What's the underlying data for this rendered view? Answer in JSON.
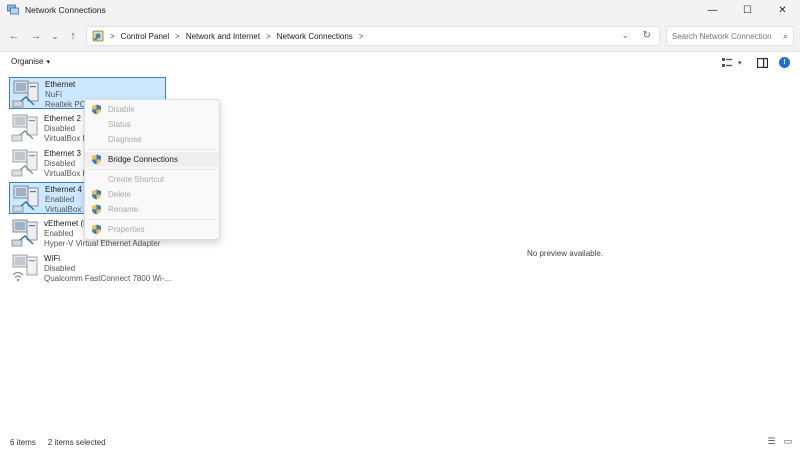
{
  "window": {
    "title": "Network Connections",
    "minimize": "—",
    "maximize": "☐",
    "close": "✕"
  },
  "nav": {
    "back": "←",
    "forward": "→",
    "recent": "⌄",
    "up": "↑",
    "breadcrumb": [
      "Control Panel",
      "Network and Internet",
      "Network Connections"
    ],
    "separator": ">",
    "search_placeholder": "Search Network Connections"
  },
  "command_bar": {
    "organise_label": "Organise",
    "organise_caret": "▾"
  },
  "items": [
    {
      "name": "Ethernet",
      "status": "NuFi",
      "adapter": "Realtek PCIe",
      "selected": true
    },
    {
      "name": "Ethernet 2",
      "status": "Disabled",
      "adapter": "VirtualBox H",
      "selected": false
    },
    {
      "name": "Ethernet 3",
      "status": "Disabled",
      "adapter": "VirtualBox H",
      "selected": false
    },
    {
      "name": "Ethernet 4",
      "status": "Enabled",
      "adapter": "VirtualBox H",
      "selected": true
    },
    {
      "name": "vEthernet (D",
      "status": "Enabled",
      "adapter": "Hyper-V Virtual Ethernet Adapter",
      "selected": false
    },
    {
      "name": "WiFi",
      "status": "Disabled",
      "adapter": "Qualcomm FastConnect 7800 Wi-...",
      "selected": false
    }
  ],
  "preview_text": "No preview available.",
  "context_menu": {
    "items": [
      {
        "label": "Disable",
        "icon": "shield-icon",
        "enabled": false
      },
      {
        "label": "Status",
        "icon": "none",
        "enabled": false
      },
      {
        "label": "Diagnose",
        "icon": "none",
        "enabled": false
      },
      {
        "label": "Bridge Connections",
        "icon": "shield-icon",
        "enabled": true
      },
      {
        "label": "Create Shortcut",
        "icon": "none",
        "enabled": false
      },
      {
        "label": "Delete",
        "icon": "shield-icon",
        "enabled": false
      },
      {
        "label": "Rename",
        "icon": "shield-icon",
        "enabled": false
      },
      {
        "label": "Properties",
        "icon": "shield-icon",
        "enabled": false
      }
    ]
  },
  "status_bar": {
    "item_count": "6 items",
    "selection": "2 items selected"
  },
  "colors": {
    "selection_bg": "#cce8ff",
    "selection_border": "#3e7dbd",
    "accent": "#1f6fd6"
  }
}
